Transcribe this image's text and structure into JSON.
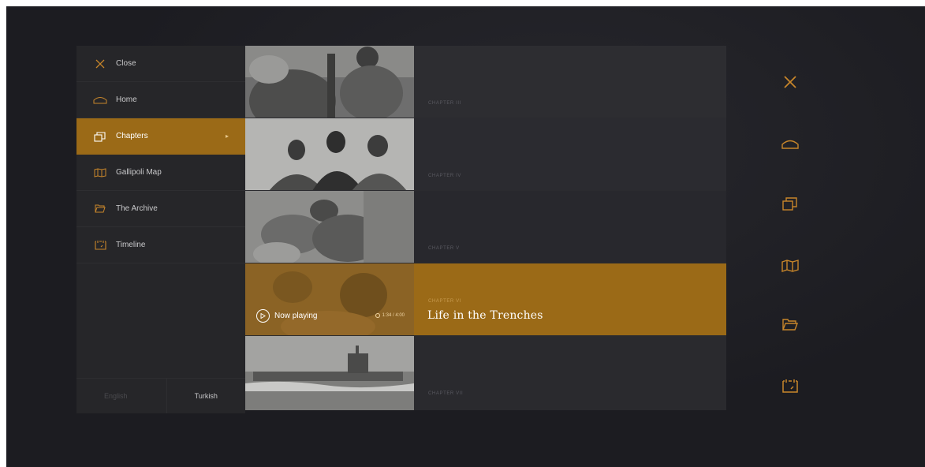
{
  "colors": {
    "accent": "#9b6a17",
    "accent_icon": "#c8862a",
    "background": "#1c1c21",
    "menu_bg": "#262629"
  },
  "menu": {
    "items": [
      {
        "label": "Close",
        "icon": "close-icon",
        "active": false
      },
      {
        "label": "Home",
        "icon": "home-icon",
        "active": false
      },
      {
        "label": "Chapters",
        "icon": "chapters-icon",
        "active": true
      },
      {
        "label": "Gallipoli Map",
        "icon": "map-icon",
        "active": false
      },
      {
        "label": "The Archive",
        "icon": "folder-icon",
        "active": false
      },
      {
        "label": "Timeline",
        "icon": "timeline-icon",
        "active": false
      }
    ],
    "active_arrow": "▸"
  },
  "language": {
    "english": "English",
    "turkish": "Turkish"
  },
  "chapters": [
    {
      "label": "CHAPTER III",
      "active": false
    },
    {
      "label": "CHAPTER IV",
      "active": false
    },
    {
      "label": "CHAPTER V",
      "active": false
    },
    {
      "label": "CHAPTER VI",
      "title": "Life in the Trenches",
      "now_playing": "Now playing",
      "duration": "1:34 / 4:00",
      "active": true
    },
    {
      "label": "CHAPTER VII",
      "active": false
    }
  ],
  "rail": {
    "icons": [
      "close-icon",
      "home-icon",
      "chapters-icon",
      "map-icon",
      "folder-icon",
      "timeline-icon"
    ]
  }
}
